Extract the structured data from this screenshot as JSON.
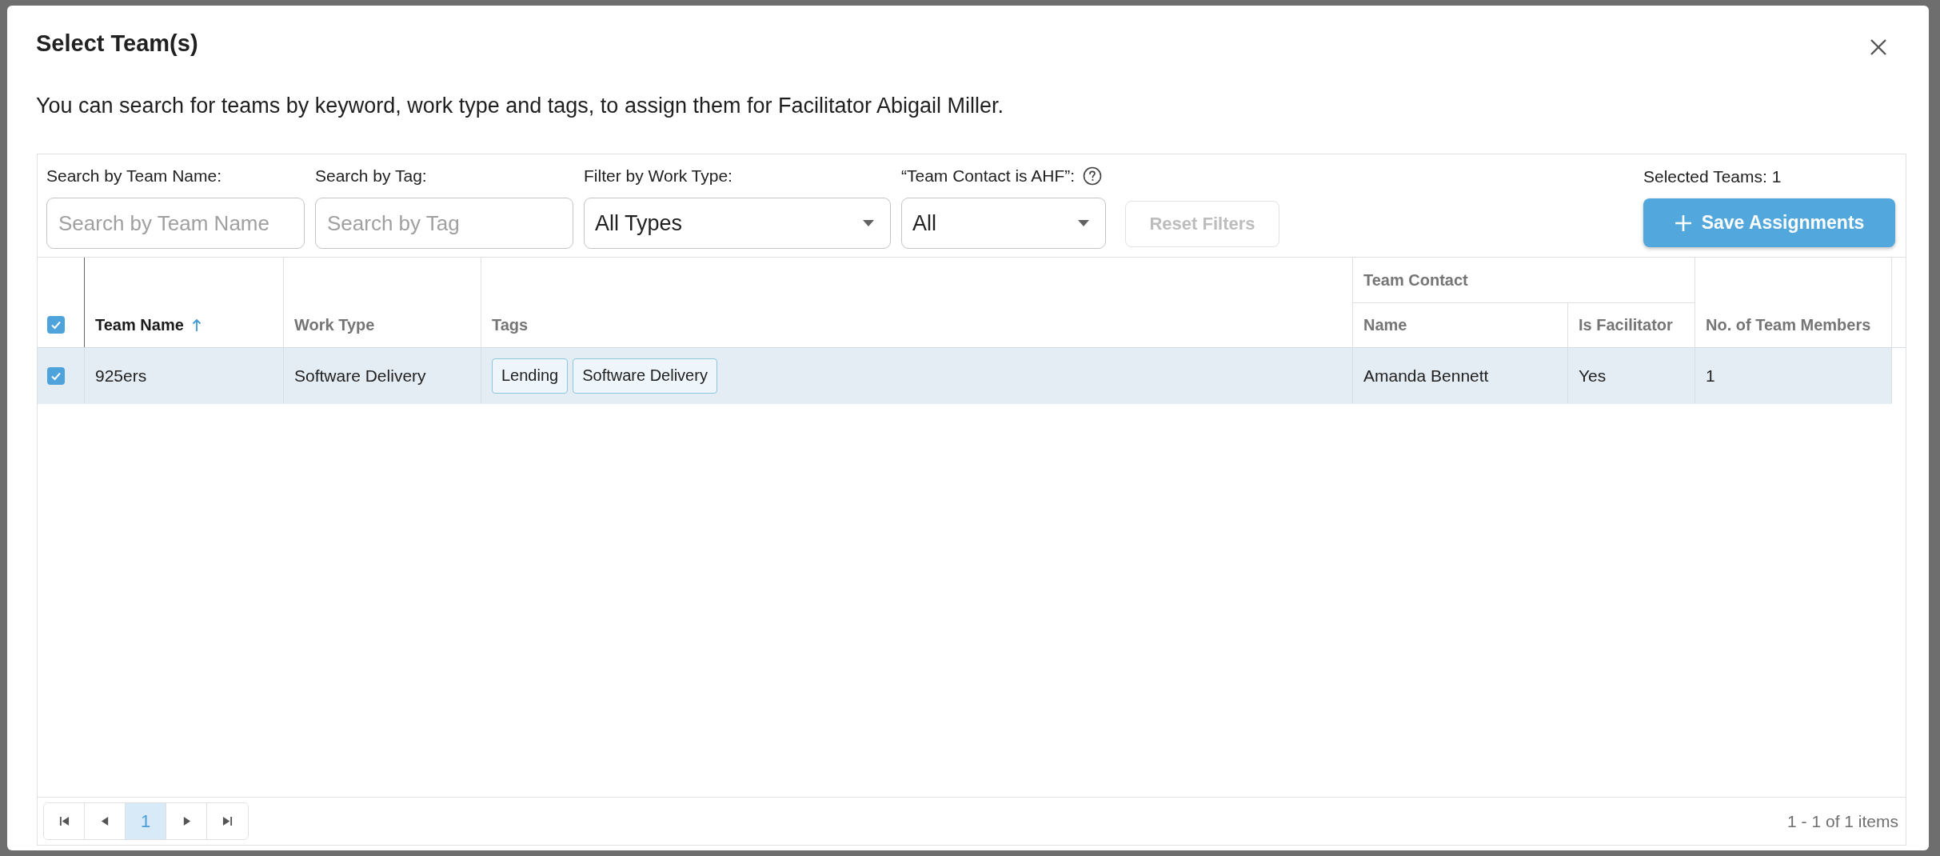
{
  "dialog": {
    "title": "Select Team(s)",
    "description": "You can search for teams by keyword, work type and tags, to assign them for Facilitator Abigail Miller."
  },
  "filters": [
    {
      "kind": "text",
      "label": "Search by Team Name:",
      "placeholder": "Search by Team Name",
      "help": false
    },
    {
      "kind": "text",
      "label": "Search by Tag:",
      "placeholder": "Search by Tag",
      "help": false
    },
    {
      "kind": "select",
      "label": "Filter by Work Type:",
      "value": "All Types",
      "help": false
    },
    {
      "kind": "select",
      "label": "“Team Contact is AHF”:",
      "value": "All",
      "help": true
    }
  ],
  "reset_button": {
    "label": "Reset Filters",
    "disabled": true
  },
  "selection": {
    "count_label": "Selected Teams: 1"
  },
  "save_button": {
    "label": "Save Assignments"
  },
  "table": {
    "select_all": {
      "checked": true
    },
    "columns": [
      {
        "label": "Team Name",
        "sorted": true
      },
      {
        "label": "Work Type",
        "sorted": false
      },
      {
        "label": "Tags",
        "sorted": false
      },
      {
        "label": "Team Contact",
        "sorted": false,
        "children": [
          {
            "label": "Name",
            "sorted": false
          },
          {
            "label": "Is Facilitator",
            "sorted": false
          }
        ]
      },
      {
        "label": "No. of Team Members",
        "sorted": false
      }
    ],
    "rows": [
      {
        "selected": true,
        "team_name": "925ers",
        "work_type": "Software Delivery",
        "tags": [
          "Lending",
          "Software Delivery"
        ],
        "contact_name": "Amanda Bennett",
        "is_facilitator": "Yes",
        "team_members": "1"
      }
    ]
  },
  "pagination": {
    "pages": [
      {
        "label": "1",
        "selected": true
      }
    ],
    "summary": "1 - 1 of 1 items"
  }
}
